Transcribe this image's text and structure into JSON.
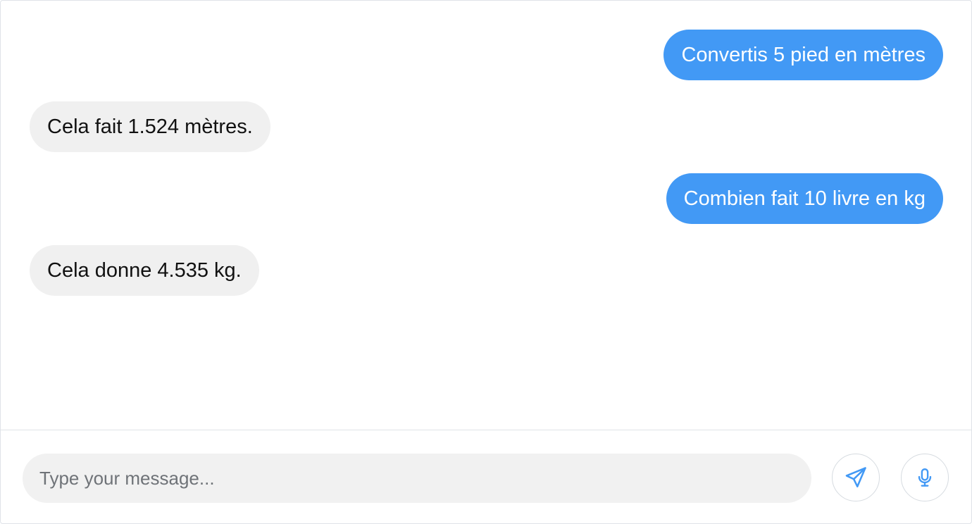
{
  "messages": [
    {
      "role": "user",
      "text": "Convertis 5 pied en mètres"
    },
    {
      "role": "assistant",
      "text": "Cela fait 1.524 mètres."
    },
    {
      "role": "user",
      "text": "Combien fait 10 livre en kg"
    },
    {
      "role": "assistant",
      "text": "Cela donne 4.535 kg."
    }
  ],
  "composer": {
    "input_value": "",
    "input_placeholder": "Type your message...",
    "send_icon": "send-icon",
    "mic_icon": "microphone-icon"
  },
  "colors": {
    "user_bubble": "#4299f5",
    "assistant_bubble": "#f0f0f0",
    "input_background": "#f1f1f1",
    "icon_accent": "#4299f5"
  }
}
